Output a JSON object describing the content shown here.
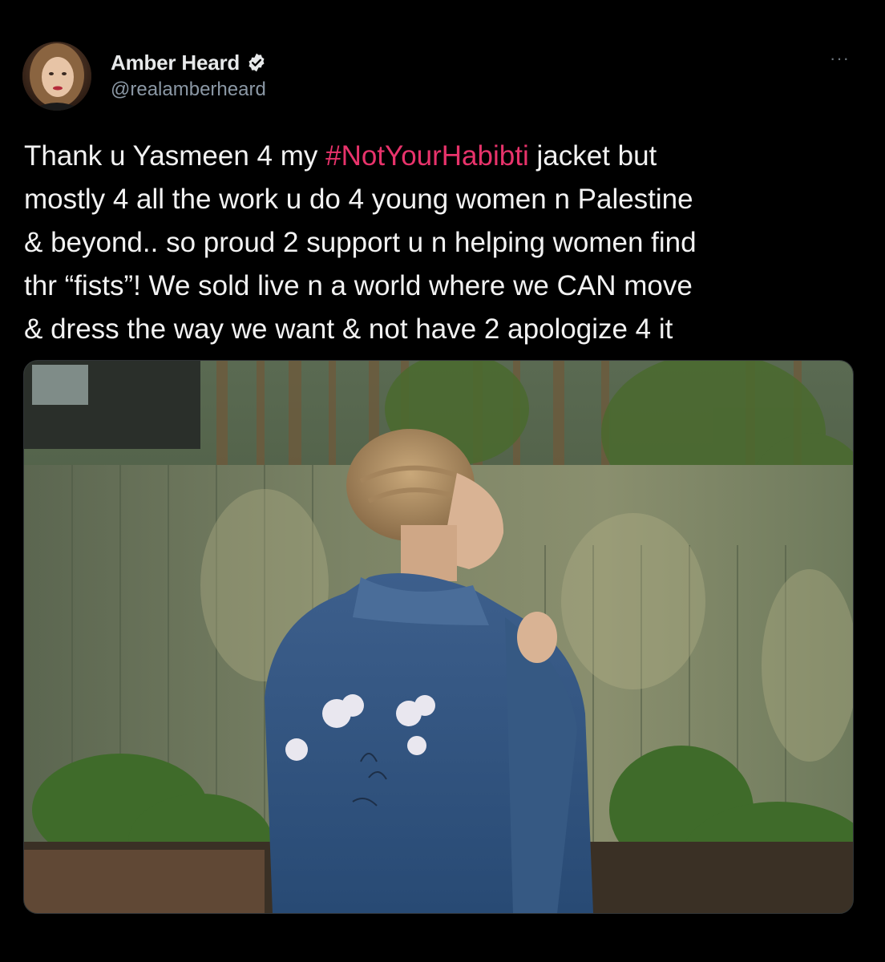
{
  "author": {
    "display_name": "Amber Heard",
    "handle": "@realamberheard",
    "verified": true,
    "verified_icon": "verified-badge-icon"
  },
  "menu": {
    "more_label": "···",
    "more_icon": "more-options-icon"
  },
  "tweet": {
    "text_before": "Thank u Yasmeen 4 my ",
    "hashtag": "#NotYourHabibti",
    "text_after": " jacket but\nmostly 4 all the work u do 4 young women n Palestine\n& beyond.. so proud 2 support u n helping women find\nthr “fists”! We sold live n a world where we CAN move\n& dress the way we want & not have 2 apologize 4 it"
  },
  "colors": {
    "background": "#000000",
    "text": "#e7e9ea",
    "muted": "#8b98a5",
    "hashtag": "#e8336b"
  },
  "media": {
    "type": "photo",
    "subject": "woman in embroidered denim jacket seen from behind in a garden"
  }
}
